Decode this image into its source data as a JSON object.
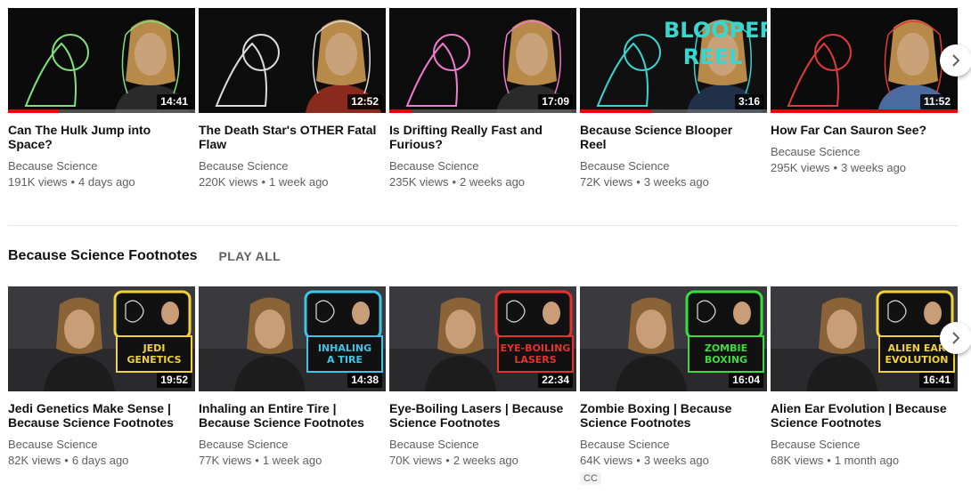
{
  "top_shelf": {
    "videos": [
      {
        "title": "Can The Hulk Jump into Space?",
        "channel": "Because Science",
        "views": "191K views",
        "age": "4 days ago",
        "duration": "14:41",
        "progress": 0.27
      },
      {
        "title": "The Death Star's OTHER Fatal Flaw",
        "channel": "Because Science",
        "views": "220K views",
        "age": "1 week ago",
        "duration": "12:52",
        "progress": 0
      },
      {
        "title": "Is Drifting Really Fast and Furious?",
        "channel": "Because Science",
        "views": "235K views",
        "age": "2 weeks ago",
        "duration": "17:09",
        "progress": 0.12
      },
      {
        "title": "Because Science Blooper Reel",
        "channel": "Because Science",
        "views": "72K views",
        "age": "3 weeks ago",
        "duration": "3:16",
        "progress": 0.38
      },
      {
        "title": "How Far Can Sauron See?",
        "channel": "Because Science",
        "views": "295K views",
        "age": "3 weeks ago",
        "duration": "11:52",
        "progress": 1.0
      }
    ]
  },
  "footnotes_shelf": {
    "title": "Because Science Footnotes",
    "play_all": "PLAY ALL",
    "videos": [
      {
        "title": "Jedi Genetics Make Sense | Because Science Footnotes",
        "channel": "Because Science",
        "views": "82K views",
        "age": "6 days ago",
        "duration": "19:52",
        "thumb_text": [
          "JEDI",
          "GENETICS"
        ],
        "accent": "#f0d23a"
      },
      {
        "title": "Inhaling an Entire Tire | Because Science Footnotes",
        "channel": "Because Science",
        "views": "77K views",
        "age": "1 week ago",
        "duration": "14:38",
        "thumb_text": [
          "INHALING",
          "A TIRE"
        ],
        "accent": "#39c6e8"
      },
      {
        "title": "Eye-Boiling Lasers | Because Science Footnotes",
        "channel": "Because Science",
        "views": "70K views",
        "age": "2 weeks ago",
        "duration": "22:34",
        "thumb_text": [
          "EYE-BOILING",
          "LASERS"
        ],
        "accent": "#e8312c"
      },
      {
        "title": "Zombie Boxing | Because Science Footnotes",
        "channel": "Because Science",
        "views": "64K views",
        "age": "3 weeks ago",
        "duration": "16:04",
        "thumb_text": [
          "ZOMBIE",
          "BOXING"
        ],
        "accent": "#3ddc3d",
        "badge": "CC"
      },
      {
        "title": "Alien Ear Evolution | Because Science Footnotes",
        "channel": "Because Science",
        "views": "68K views",
        "age": "1 month ago",
        "duration": "16:41",
        "thumb_text": [
          "ALIEN EAR",
          "EVOLUTION"
        ],
        "accent": "#f0d23a"
      }
    ]
  },
  "top_thumb_overlay": {
    "blooper": [
      "BLOOPER",
      "REEL"
    ]
  },
  "icons": {
    "next": "chevron-right-icon"
  }
}
